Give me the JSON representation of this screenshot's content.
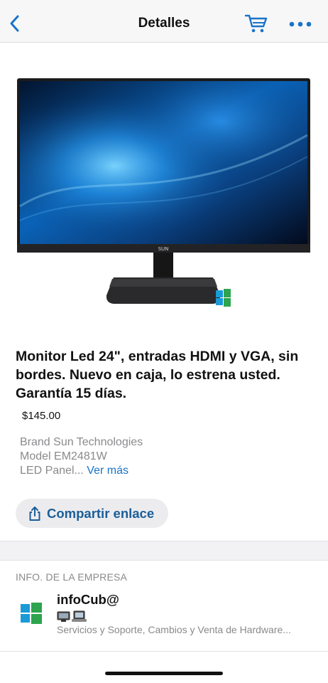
{
  "nav": {
    "title": "Detalles",
    "back_icon": "chevron-left-icon",
    "cart_icon": "cart-icon",
    "more_icon": "more-dots-icon",
    "accent": "#1a73c9"
  },
  "product": {
    "image": "monitor-image",
    "title": "Monitor Led 24\", entradas HDMI y VGA, sin bordes. Nuevo en caja, lo estrena usted. Garantía 15 días.",
    "price": "$145.00",
    "description_lines": [
      "Brand Sun Technologies",
      "Model EM2481W",
      "LED Panel..."
    ],
    "see_more": "Ver más",
    "share_label": "Compartir enlace",
    "share_icon": "share-icon"
  },
  "company": {
    "section_header": "INFO. DE LA EMPRESA",
    "name": "infoCub@",
    "logo": "windows-logo",
    "devices_icon": "computer-devices-icon",
    "description": "Servicios y Soporte, Cambios y Venta de Hardware..."
  }
}
